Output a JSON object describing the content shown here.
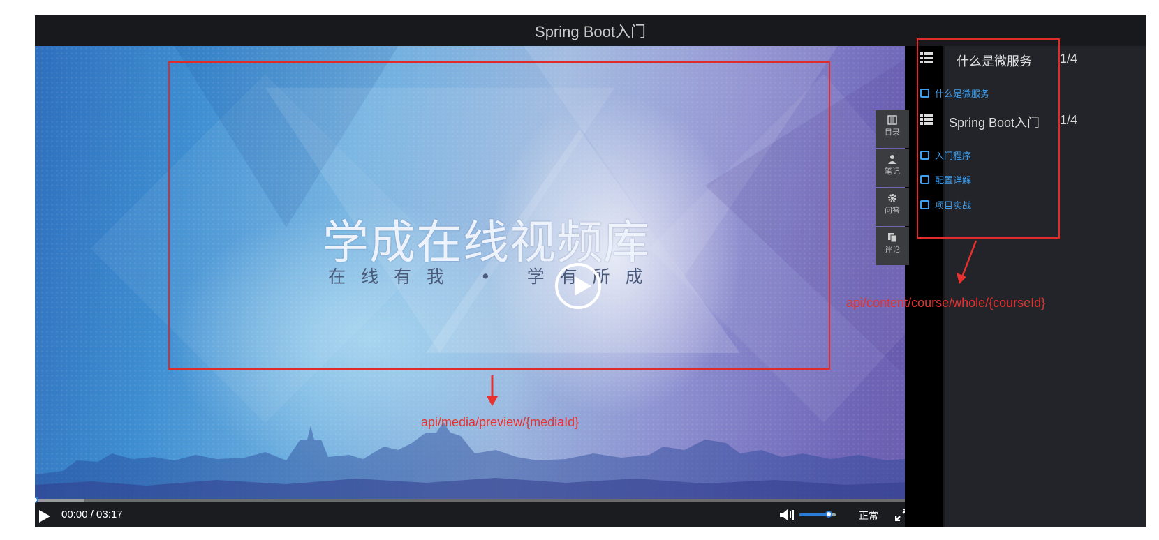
{
  "window": {
    "title": "Spring Boot入门"
  },
  "video": {
    "headline": "学成在线视频库",
    "slogan": "在线有我 • 学有所成",
    "annotation": "api/media/preview/{mediaId}"
  },
  "controls": {
    "time": "00:00 / 03:17",
    "rate": "正常",
    "volume_percent": 80,
    "progress_percent": 0,
    "buffered_percent": 5.6
  },
  "side_buttons": [
    {
      "label": "目录",
      "icon": "catalog-icon"
    },
    {
      "label": "笔记",
      "icon": "user-icon"
    },
    {
      "label": "问答",
      "icon": "gear-icon"
    },
    {
      "label": "评论",
      "icon": "copy-icon"
    }
  ],
  "chapters": [
    {
      "title": "什么是微服务",
      "count": "1/4",
      "lessons": [
        "什么是微服务"
      ]
    },
    {
      "title": "Spring Boot入门",
      "count": "1/4",
      "lessons": [
        "入门程序",
        "配置详解",
        "项目实战"
      ]
    }
  ],
  "panel_annotation": "api/content/course/whole/{courseId}",
  "colors": {
    "annotation": "#e8302e",
    "accent": "#3e9ff0",
    "background": "#17191c"
  }
}
